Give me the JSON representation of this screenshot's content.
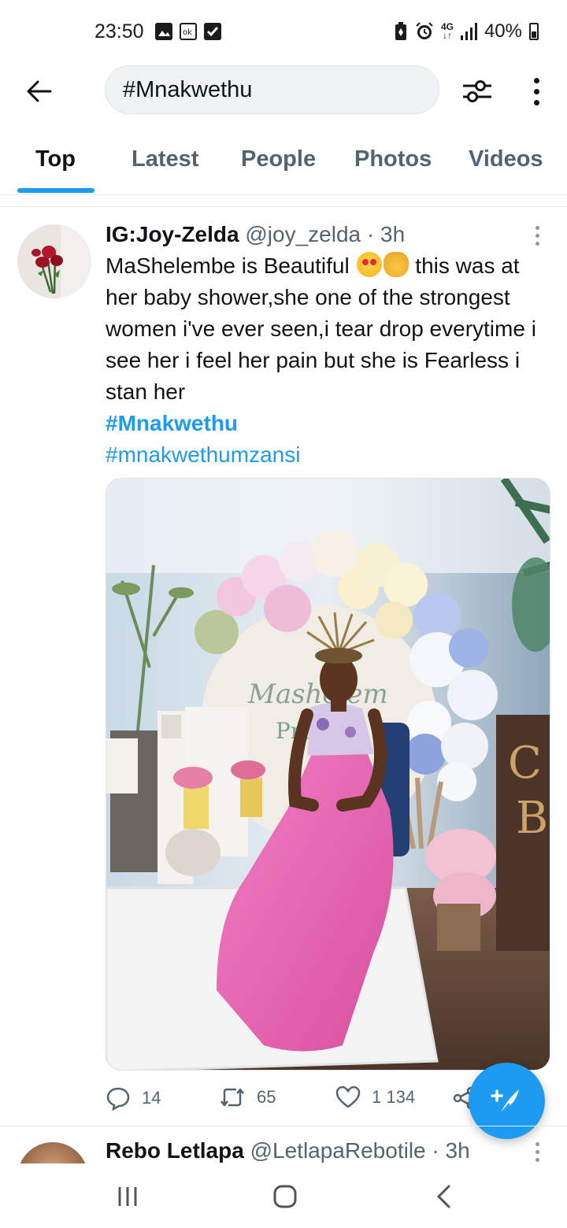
{
  "status_bar": {
    "time": "23:50",
    "battery": "40%",
    "network": "4G",
    "left_icons": [
      "gallery-icon",
      "data-saver-icon",
      "check-icon"
    ],
    "right_icons": [
      "battery-saver-icon",
      "alarm-icon",
      "signal-icon",
      "battery-icon"
    ]
  },
  "header": {
    "search_value": "#Mnakwethu",
    "back_icon": "arrow-left-icon",
    "filter_icon": "filter-icon",
    "more_icon": "more-vertical-icon"
  },
  "tabs": [
    {
      "label": "Top",
      "active": true
    },
    {
      "label": "Latest",
      "active": false
    },
    {
      "label": "People",
      "active": false
    },
    {
      "label": "Photos",
      "active": false
    },
    {
      "label": "Videos",
      "active": false
    }
  ],
  "tweets": [
    {
      "display_name": "IG:Joy-Zelda",
      "handle": "@joy_zelda",
      "separator": " · ",
      "time": "3h",
      "text_before_emoji": "MaShelembe is Beautiful ",
      "emojis": [
        "heart-eyes-emoji",
        "ok-hand-emoji"
      ],
      "text_after_emoji": " this was at her baby shower,she one of the strongest women i've ever seen,i tear drop everytime i see her i feel her pain but she is Fearless i stan her",
      "hashtags": [
        "#Mnakwethu",
        "#mnakwethumzansi"
      ],
      "replies": "14",
      "retweets": "65",
      "likes": "1 134"
    },
    {
      "display_name": "Rebo Letlapa",
      "handle": "@LetlapaRebotile",
      "separator": " · ",
      "time": "3h"
    }
  ],
  "colors": {
    "accent": "#1d9bf0",
    "text_primary": "#0f1419",
    "text_secondary": "#536471"
  }
}
